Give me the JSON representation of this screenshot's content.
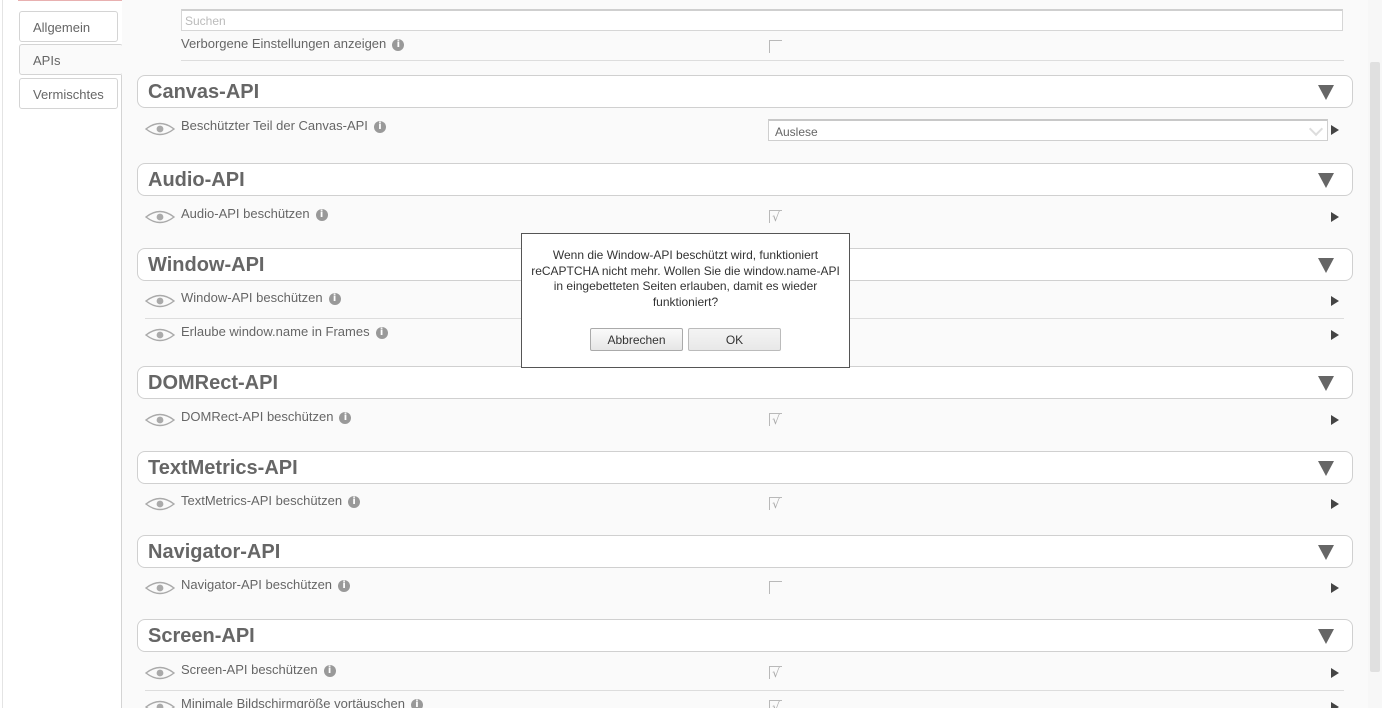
{
  "sidebar": {
    "tabs": [
      {
        "label": "Allgemein"
      },
      {
        "label": "APIs"
      },
      {
        "label": "Vermischtes"
      }
    ]
  },
  "search": {
    "placeholder": "Suchen"
  },
  "hidden_settings": {
    "label": "Verborgene Einstellungen anzeigen",
    "checked": false
  },
  "sections": {
    "canvas": {
      "title": "Canvas-API",
      "rows": [
        {
          "label": "Beschützter Teil der Canvas-API",
          "select_value": "Auslese"
        }
      ]
    },
    "audio": {
      "title": "Audio-API",
      "rows": [
        {
          "label": "Audio-API beschützen",
          "checked": true
        }
      ]
    },
    "window": {
      "title": "Window-API",
      "rows": [
        {
          "label": "Window-API beschützen"
        },
        {
          "label": "Erlaube window.name in Frames"
        }
      ]
    },
    "domrect": {
      "title": "DOMRect-API",
      "rows": [
        {
          "label": "DOMRect-API beschützen",
          "checked": true
        }
      ]
    },
    "textmetrics": {
      "title": "TextMetrics-API",
      "rows": [
        {
          "label": "TextMetrics-API beschützen",
          "checked": true
        }
      ]
    },
    "navigator": {
      "title": "Navigator-API",
      "rows": [
        {
          "label": "Navigator-API beschützen",
          "checked": false
        }
      ]
    },
    "screen": {
      "title": "Screen-API",
      "rows": [
        {
          "label": "Screen-API beschützen",
          "checked": true
        },
        {
          "label": "Minimale Bildschirmgröße vortäuschen",
          "checked": true
        }
      ]
    }
  },
  "dialog": {
    "message": "Wenn die Window-API beschützt wird, funktioniert reCAPTCHA nicht mehr. Wollen Sie die window.name-API in eingebetteten Seiten erlauben, damit es wieder funktioniert?",
    "cancel_label": "Abbrechen",
    "ok_label": "OK"
  },
  "glyphs": {
    "info": "i",
    "check": "√"
  },
  "icons": {
    "info": "info-icon",
    "eye": "eye-icon",
    "expand": "triangle-down-icon",
    "details": "play-arrow-icon"
  }
}
